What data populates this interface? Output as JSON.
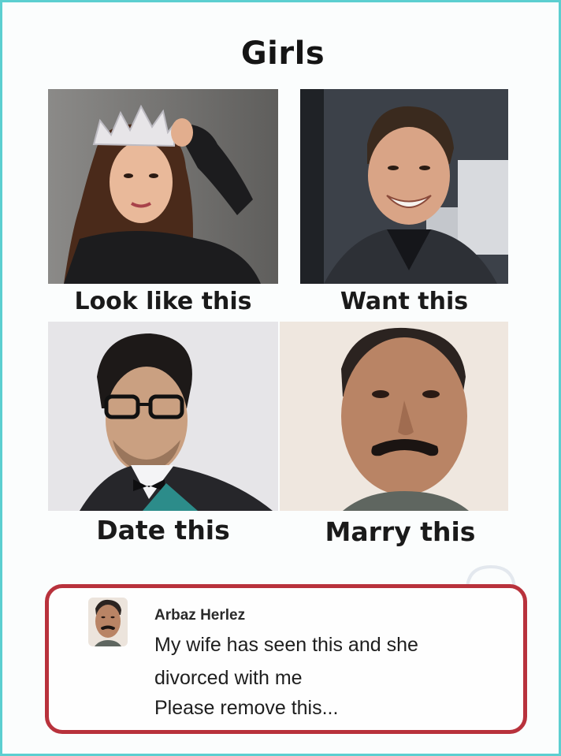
{
  "title": "Girls",
  "panels": [
    {
      "caption": "Look like this",
      "icon": "woman-with-crown-photo"
    },
    {
      "caption": "Want this",
      "icon": "smiling-man-photo"
    },
    {
      "caption": "Date this",
      "icon": "man-with-glasses-photo"
    },
    {
      "caption": "Marry this",
      "icon": "mustached-man-photo"
    }
  ],
  "comment": {
    "author": "Arbaz Herlez",
    "lines": [
      "My wife has seen this and she",
      "divorced with me",
      "Please remove this..."
    ],
    "avatar_icon": "mustached-man-avatar"
  },
  "colors": {
    "border": "#5ccfd0",
    "comment_border": "#b8323c"
  }
}
